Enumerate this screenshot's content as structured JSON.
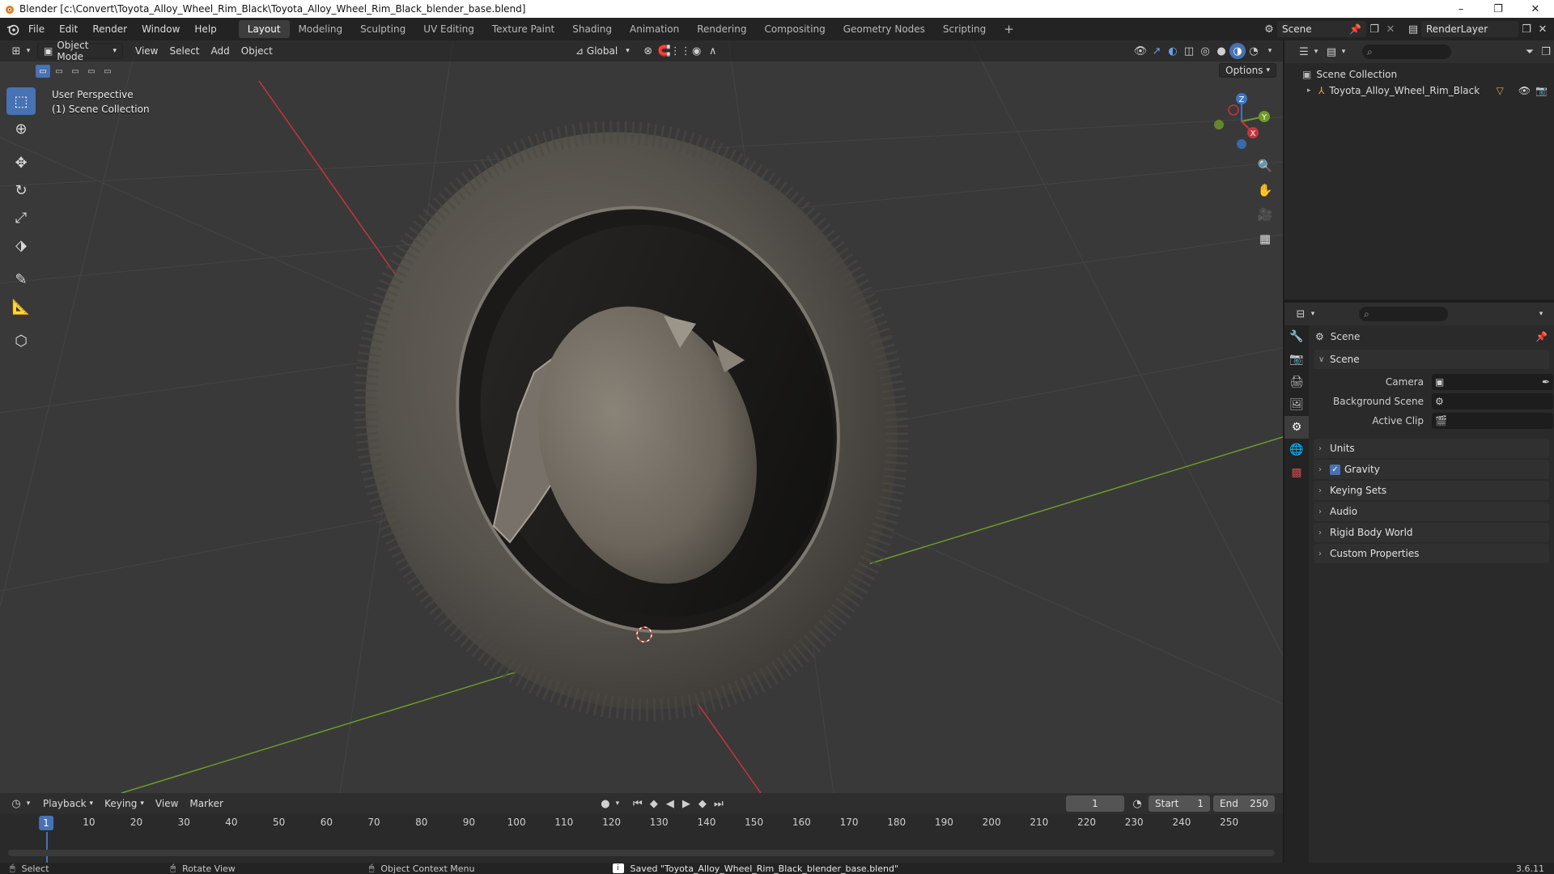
{
  "window": {
    "title": "Blender [c:\\Convert\\Toyota_Alloy_Wheel_Rim_Black\\Toyota_Alloy_Wheel_Rim_Black_blender_base.blend]",
    "minimize": "–",
    "maximize": "❐",
    "close": "✕"
  },
  "menu": [
    "File",
    "Edit",
    "Render",
    "Window",
    "Help"
  ],
  "workspaces": [
    "Layout",
    "Modeling",
    "Sculpting",
    "UV Editing",
    "Texture Paint",
    "Shading",
    "Animation",
    "Rendering",
    "Compositing",
    "Geometry Nodes",
    "Scripting"
  ],
  "active_workspace": "Layout",
  "add_workspace": "+",
  "scene_name": "Scene",
  "view_layer": "RenderLayer",
  "viewport": {
    "mode": "Object Mode",
    "menus": [
      "View",
      "Select",
      "Add",
      "Object"
    ],
    "transform_orientation": "Global",
    "options_label": "Options",
    "overlay_line1": "User Perspective",
    "overlay_line2": "(1) Scene Collection",
    "gizmo": {
      "z": "Z",
      "y": "Y",
      "x": "X"
    }
  },
  "outliner": {
    "root": "Scene Collection",
    "object": "Toyota_Alloy_Wheel_Rim_Black"
  },
  "properties": {
    "context": "Scene",
    "panel_scene": "Scene",
    "camera_label": "Camera",
    "background_scene_label": "Background Scene",
    "active_clip_label": "Active Clip",
    "collapsed_panels": [
      "Units",
      "Gravity",
      "Keying Sets",
      "Audio",
      "Rigid Body World",
      "Custom Properties"
    ],
    "gravity_checked": true
  },
  "timeline": {
    "menus": [
      "Playback",
      "Keying",
      "View",
      "Marker"
    ],
    "current_frame": "1",
    "start_label": "Start",
    "start": "1",
    "end_label": "End",
    "end": "250",
    "ticks": [
      "10",
      "20",
      "30",
      "40",
      "50",
      "60",
      "70",
      "80",
      "90",
      "100",
      "110",
      "120",
      "130",
      "140",
      "150",
      "160",
      "170",
      "180",
      "190",
      "200",
      "210",
      "220",
      "230",
      "240",
      "250"
    ]
  },
  "status": {
    "select": "Select",
    "rotate": "Rotate View",
    "context_menu": "Object Context Menu",
    "message": "Saved \"Toyota_Alloy_Wheel_Rim_Black_blender_base.blend\"",
    "version": "3.6.11"
  },
  "colors": {
    "accent": "#4772b3",
    "x_axis": "#c8343f",
    "y_axis": "#6f9a2a",
    "z_axis": "#3b76c8",
    "viewport_bg": "#393939"
  }
}
